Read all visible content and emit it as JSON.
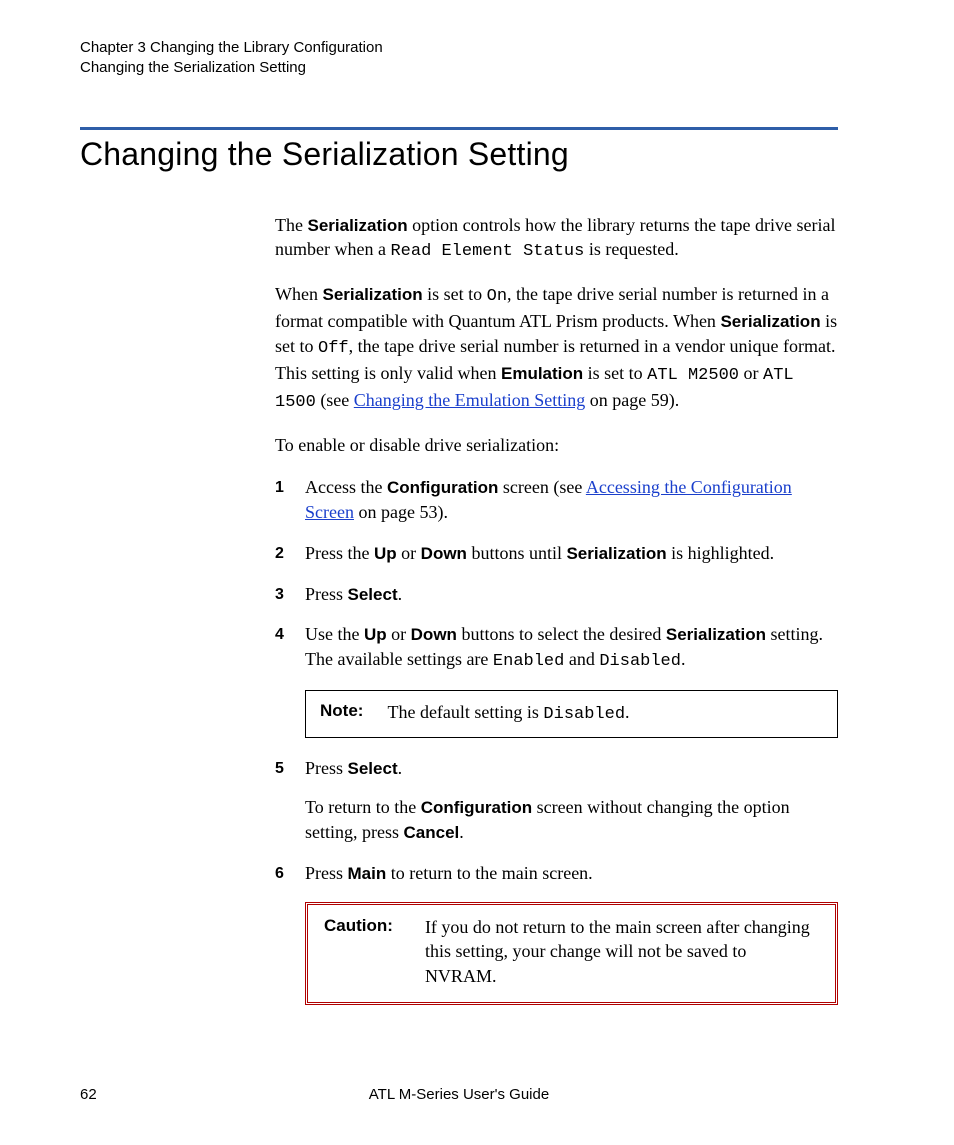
{
  "header": {
    "line1": "Chapter 3  Changing the Library Configuration",
    "line2": "Changing the Serialization Setting"
  },
  "title": "Changing the Serialization Setting",
  "intro": {
    "p1_a": "The ",
    "p1_bold": "Serialization",
    "p1_b": " option controls how the library returns the tape drive serial number when a ",
    "p1_code": "Read Element Status",
    "p1_c": " is requested.",
    "p2_a": "When ",
    "p2_bold1": "Serialization",
    "p2_b": " is set to ",
    "p2_code1": "On",
    "p2_c": ", the tape drive serial number is returned in a format compatible with Quantum ATL Prism products. When ",
    "p2_bold2": "Serialization",
    "p2_d": " is set to ",
    "p2_code2": "Off",
    "p2_e": ", the tape drive serial number is returned in a vendor unique format. This setting is only valid when ",
    "p2_bold3": "Emulation",
    "p2_f": " is set to ",
    "p2_code3": "ATL M2500",
    "p2_g": " or ",
    "p2_code4": "ATL 1500",
    "p2_h": " (see ",
    "p2_link": "Changing the Emulation Setting",
    "p2_i": " on page 59).",
    "p3": "To enable or disable drive serialization:"
  },
  "steps": {
    "s1_a": "Access the ",
    "s1_bold": "Configuration",
    "s1_b": " screen (see ",
    "s1_link": "Accessing the Configuration Screen",
    "s1_c": " on page 53).",
    "s2_a": "Press the ",
    "s2_bold1": "Up",
    "s2_b": " or ",
    "s2_bold2": "Down",
    "s2_c": " buttons until ",
    "s2_bold3": "Serialization",
    "s2_d": " is highlighted.",
    "s3_a": "Press ",
    "s3_bold": "Select",
    "s3_b": ".",
    "s4_a": "Use the ",
    "s4_bold1": "Up",
    "s4_b": " or ",
    "s4_bold2": "Down",
    "s4_c": " buttons to select the desired ",
    "s4_bold3": "Serialization",
    "s4_d": " setting. The available settings are ",
    "s4_code1": "Enabled",
    "s4_e": " and ",
    "s4_code2": "Disabled",
    "s4_f": ".",
    "note_label": "Note:",
    "note_a": "The default setting is ",
    "note_code": "Disabled",
    "note_b": ".",
    "s5_a": "Press ",
    "s5_bold": "Select",
    "s5_b": ".",
    "s5_p2a": "To return to the ",
    "s5_p2bold": "Configuration",
    "s5_p2b": " screen without changing the option setting, press ",
    "s5_p2bold2": "Cancel",
    "s5_p2c": ".",
    "s6_a": "Press ",
    "s6_bold": "Main",
    "s6_b": " to return to the main screen.",
    "caution_label": "Caution:",
    "caution_text": "If you do not return to the main screen after changing this setting, your change will not be saved to NVRAM."
  },
  "footer": {
    "page": "62",
    "title": "ATL M-Series User's Guide"
  }
}
